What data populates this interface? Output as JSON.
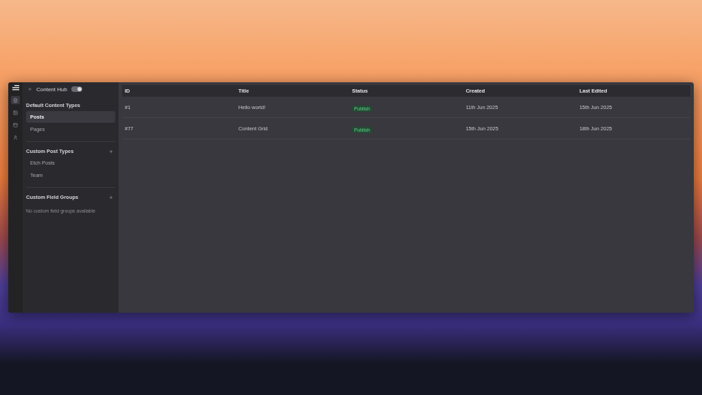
{
  "header": {
    "title": "Content Hub",
    "toggle": {
      "on": true
    }
  },
  "sidebar": {
    "sections": [
      {
        "title": "Default Content Types",
        "can_add": false,
        "items": [
          {
            "label": "Posts",
            "selected": true
          },
          {
            "label": "Pages",
            "selected": false
          }
        ]
      },
      {
        "title": "Custom Post Types",
        "can_add": true,
        "items": [
          {
            "label": "Etch Posts",
            "selected": false
          },
          {
            "label": "Team",
            "selected": false
          }
        ]
      },
      {
        "title": "Custom Field Groups",
        "can_add": true,
        "empty_text": "No custom field groups available"
      }
    ]
  },
  "rail": [
    {
      "kind": "posts",
      "selected": true
    },
    {
      "kind": "image",
      "selected": false
    },
    {
      "kind": "layout",
      "selected": false
    },
    {
      "kind": "person",
      "selected": false
    }
  ],
  "table": {
    "columns": [
      "ID",
      "Title",
      "Status",
      "Created",
      "Last Edited"
    ],
    "rows": [
      {
        "id": "#1",
        "title": "Hello world!",
        "status": "Publish",
        "created": "11th Jun 2025",
        "edited": "15th Jun 2025"
      },
      {
        "id": "#77",
        "title": "Content Grid",
        "status": "Publish",
        "created": "15th Jun 2025",
        "edited": "18th Jun 2025"
      }
    ]
  }
}
